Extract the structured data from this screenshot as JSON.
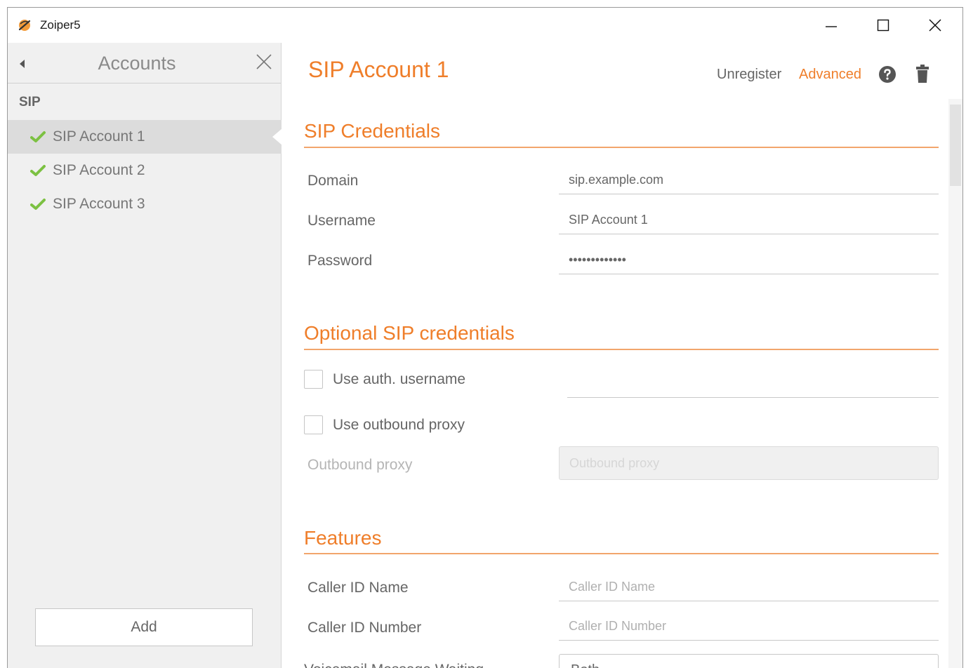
{
  "app": {
    "title": "Zoiper5"
  },
  "window_controls": {
    "minimize": "minimize-icon",
    "maximize": "maximize-icon",
    "close": "close-icon"
  },
  "sidebar": {
    "title": "Accounts",
    "group": "SIP",
    "items": [
      {
        "label": "SIP Account 1",
        "status": "registered",
        "selected": true
      },
      {
        "label": "SIP Account 2",
        "status": "registered",
        "selected": false
      },
      {
        "label": "SIP Account 3",
        "status": "registered",
        "selected": false
      }
    ],
    "add_label": "Add"
  },
  "header": {
    "title": "SIP Account 1",
    "unregister_label": "Unregister",
    "advanced_label": "Advanced"
  },
  "colors": {
    "accent": "#ef7e2a",
    "check": "#7cc142"
  },
  "sections": {
    "credentials": {
      "title": "SIP Credentials",
      "domain_label": "Domain",
      "domain_value": "sip.example.com",
      "username_label": "Username",
      "username_value": "SIP Account 1",
      "password_label": "Password",
      "password_value": "•••••••••••••"
    },
    "optional": {
      "title": "Optional SIP credentials",
      "use_auth_label": "Use auth. username",
      "use_proxy_label": "Use outbound proxy",
      "proxy_label": "Outbound proxy",
      "proxy_placeholder": "Outbound proxy"
    },
    "features": {
      "title": "Features",
      "caller_id_name_label": "Caller ID Name",
      "caller_id_name_placeholder": "Caller ID Name",
      "caller_id_number_label": "Caller ID Number",
      "caller_id_number_placeholder": "Caller ID Number",
      "voicemail_label": "Voicemail Message Waiting",
      "voicemail_value": "Both"
    }
  }
}
